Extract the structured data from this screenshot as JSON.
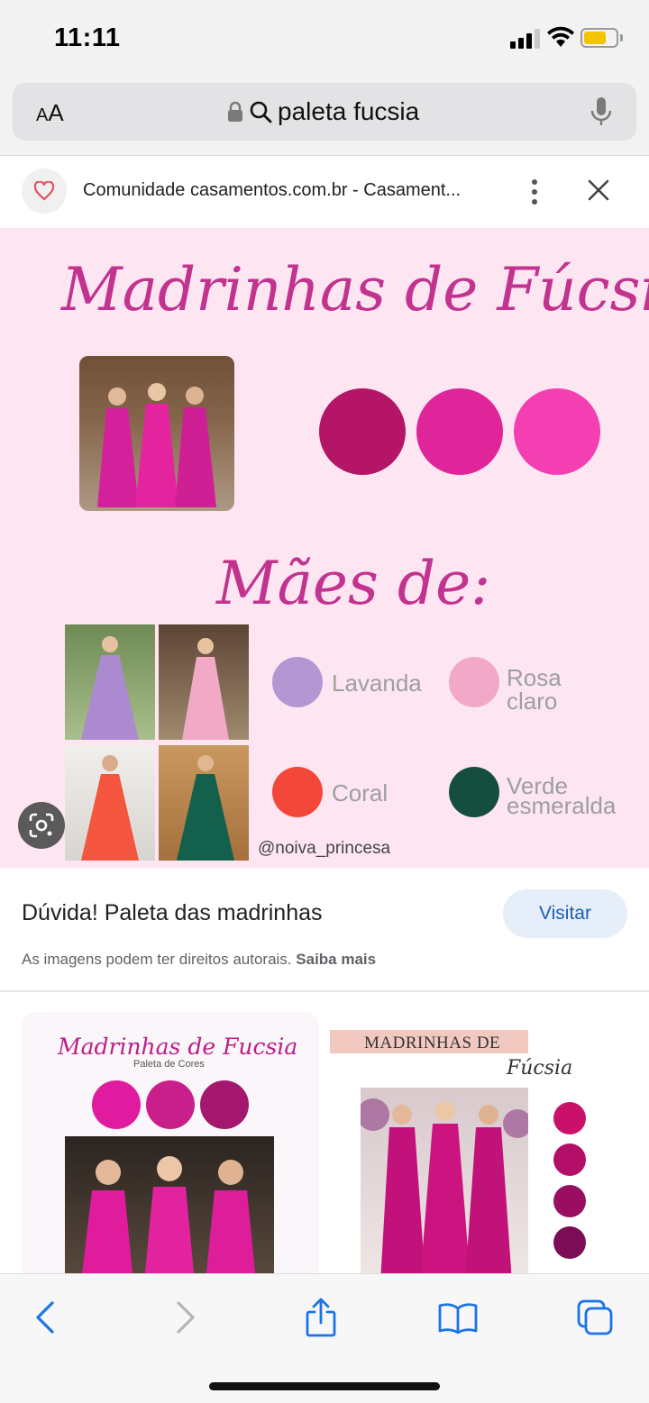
{
  "status_bar": {
    "time": "11:11",
    "battery_color": "#f5c400"
  },
  "address_bar": {
    "text_size_small": "A",
    "text_size_large": "A",
    "query": "paleta fucsia"
  },
  "source": {
    "title": "Comunidade casamentos.com.br - Casament..."
  },
  "main_image": {
    "title": "Madrinhas de Fúcsia",
    "subtitle": "Mães de:",
    "swatches": [
      {
        "label_1": "Lavanda",
        "label_2": "",
        "color": "#b496d3"
      },
      {
        "label_1": "Rosa",
        "label_2": "claro",
        "color": "#f2a9c8"
      },
      {
        "label_1": "Coral",
        "label_2": "",
        "color": "#f3473a"
      },
      {
        "label_1": "Verde",
        "label_2": "esmeralda",
        "color": "#164e3e"
      }
    ],
    "fuchsia_dots": [
      "#b41566",
      "#e0249a",
      "#f43fb2"
    ],
    "handle": "@noiva_princesa"
  },
  "result": {
    "title": "Dúvida! Paleta das madrinhas",
    "visit_label": "Visitar",
    "copyright_text": "As imagens podem ter direitos autorais.",
    "learn_more": "Saiba mais"
  },
  "related": [
    {
      "title": "Madrinhas de Fucsia",
      "subtitle": "Paleta de Cores",
      "dots": [
        "#e11ba0",
        "#c91f8a",
        "#a3176f"
      ]
    },
    {
      "title": "MADRINHAS DE",
      "script": "Fúcsia",
      "dots": [
        "#c9116a",
        "#b30f69",
        "#9a0e62",
        "#7c0c55"
      ]
    }
  ],
  "toolbar": {
    "back": "back-icon",
    "forward": "forward-icon",
    "share": "share-icon",
    "bookmarks": "book-icon",
    "tabs": "tabs-icon"
  }
}
